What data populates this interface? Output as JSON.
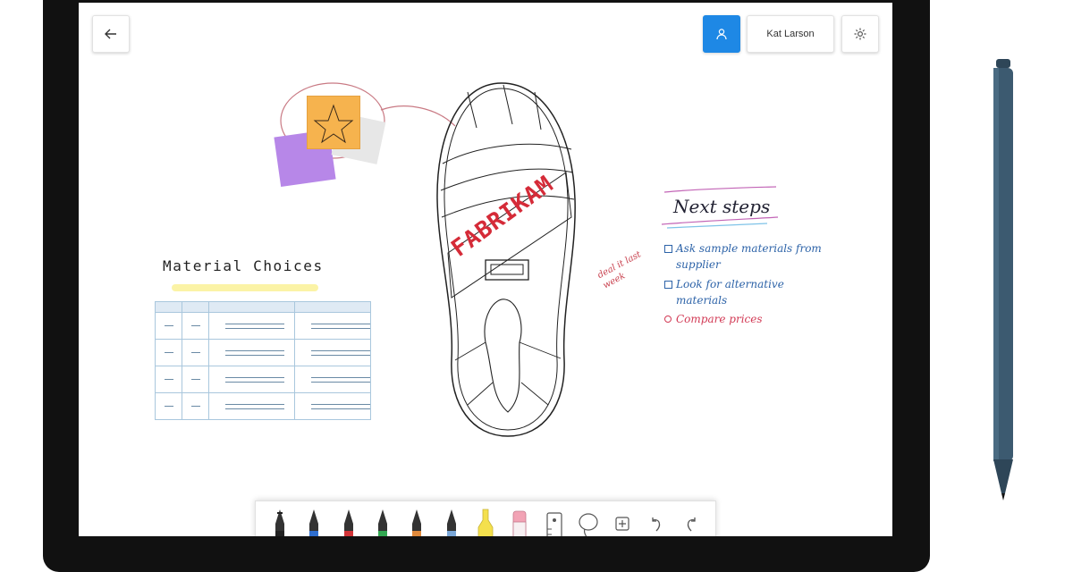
{
  "header": {
    "back_icon": "arrow-left-icon",
    "user_icon": "person-icon",
    "user_name": "Kat Larson",
    "settings_icon": "gear-icon"
  },
  "canvas": {
    "material": {
      "title": "Material Choices"
    },
    "shoe": {
      "brand_text": "FABRIKAM"
    },
    "next_steps": {
      "title": "Next steps",
      "items": [
        {
          "text": "Ask sample materials from supplier",
          "color": "#2d63a8",
          "marker": "checkbox"
        },
        {
          "text": "Look for alternative materials",
          "color": "#2d63a8",
          "marker": "checkbox"
        },
        {
          "text": "Compare prices",
          "color": "#d23a55",
          "marker": "bullet"
        }
      ],
      "side_note": "deal it last week"
    },
    "sticky_notes": [
      "#b787e8",
      "#e7e7e7",
      "#f6b34e"
    ]
  },
  "toolbar": {
    "tools": [
      {
        "name": "black-pen",
        "color": "#222222"
      },
      {
        "name": "blue-pen",
        "color": "#2f6fd0"
      },
      {
        "name": "red-pen",
        "color": "#d13438"
      },
      {
        "name": "green-pen",
        "color": "#33a852"
      },
      {
        "name": "orange-pen",
        "color": "#e08a3c"
      },
      {
        "name": "light-blue-pen",
        "color": "#7aa7d8"
      },
      {
        "name": "yellow-highlighter",
        "color": "#f4e04d"
      },
      {
        "name": "pink-eraser",
        "color": "#f2a3b5"
      },
      {
        "name": "ruler",
        "color": "#555555"
      },
      {
        "name": "lasso",
        "color": "#555555"
      },
      {
        "name": "add",
        "color": "#555555"
      },
      {
        "name": "undo",
        "color": "#555555"
      },
      {
        "name": "redo",
        "color": "#555555"
      }
    ]
  }
}
